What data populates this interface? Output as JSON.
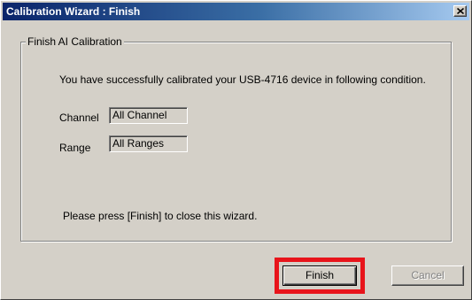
{
  "window": {
    "title": "Calibration Wizard : Finish",
    "close_label": "×"
  },
  "group": {
    "label": "Finish AI Calibration"
  },
  "message": "You have successfully calibrated your USB-4716 device in following condition.",
  "channel": {
    "label": "Channel",
    "value": "All Channel"
  },
  "range": {
    "label": "Range",
    "value": "All Ranges"
  },
  "instruction": "Please press [Finish] to close this wizard.",
  "buttons": {
    "finish": "Finish",
    "cancel": "Cancel"
  },
  "colors": {
    "highlight": "#e8141b",
    "titlebar_start": "#0a246a",
    "titlebar_end": "#a6caf0",
    "face": "#d4d0c8"
  }
}
